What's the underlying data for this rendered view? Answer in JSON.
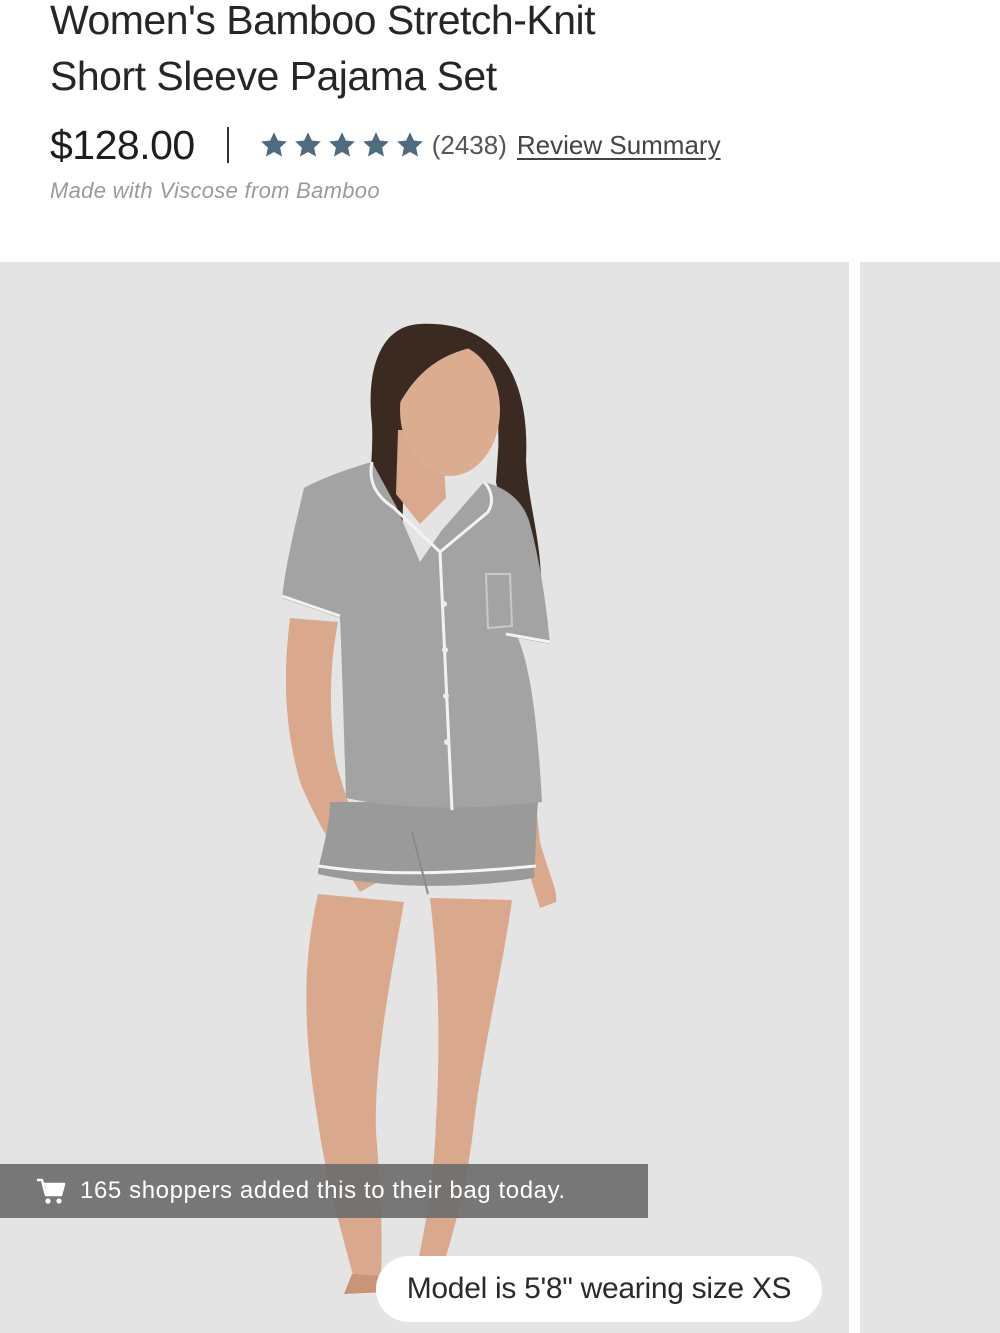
{
  "product": {
    "title_line1": "Women's Bamboo Stretch-Knit",
    "title_line2": "Short Sleeve Pajama Set",
    "price": "$128.00",
    "rating": {
      "value": 5,
      "max": 5,
      "star_color": "#4e6b80"
    },
    "review_count": "(2438)",
    "review_summary_label": "Review Summary",
    "material": "Made with Viscose from Bamboo"
  },
  "gallery": {
    "background_color": "#e4e4e4",
    "shoppers_banner": {
      "icon": "cart-icon",
      "text": "165 shoppers added this to their bag today."
    },
    "model_info": "Model is 5'8\" wearing size XS"
  }
}
